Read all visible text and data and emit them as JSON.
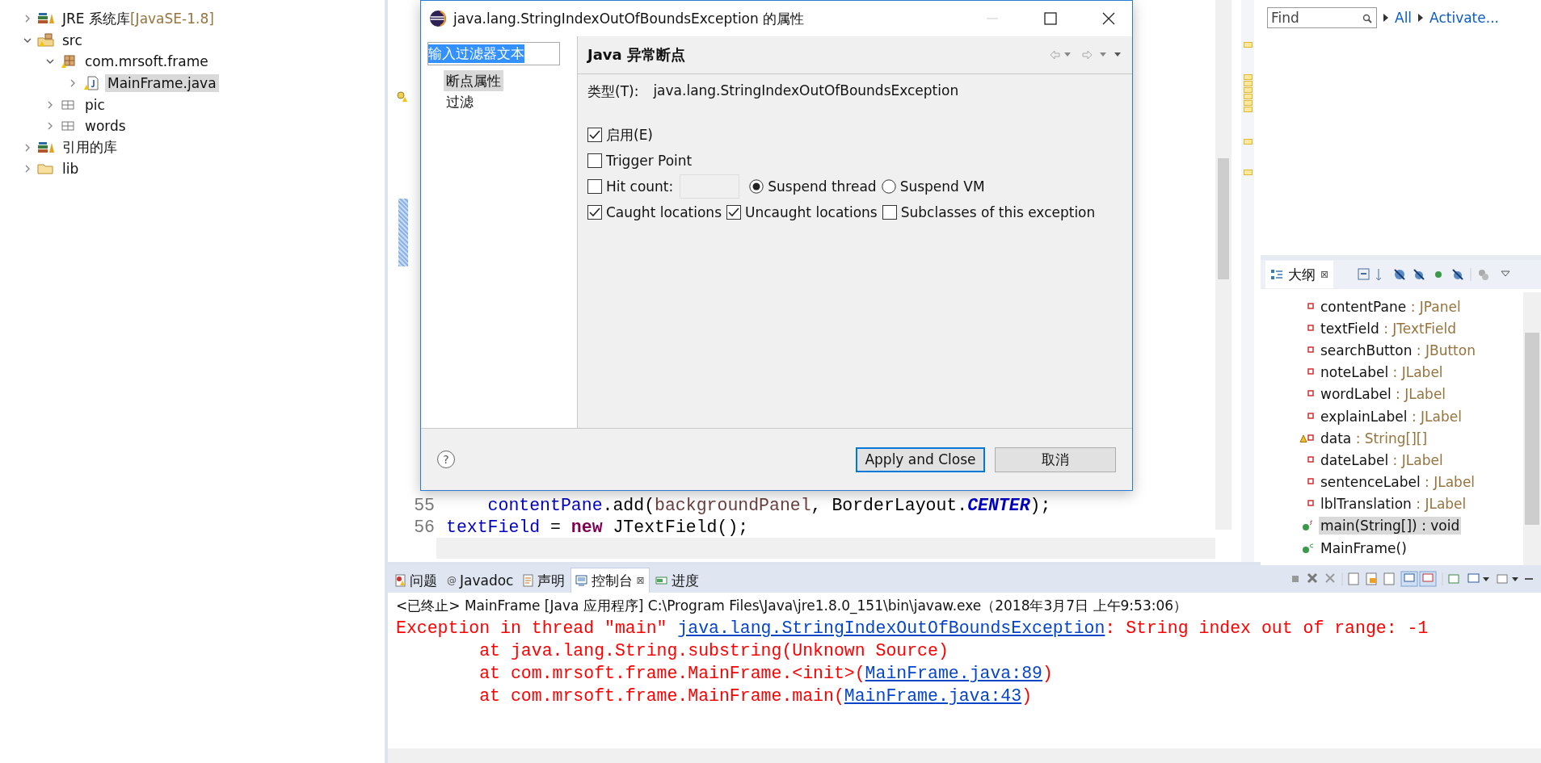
{
  "explorer": {
    "items": [
      {
        "kind": "library",
        "label": "JRE 系统库",
        "suffix": "[JavaSE-1.8]",
        "expanded": false,
        "selected": false
      },
      {
        "kind": "source",
        "label": "src",
        "expanded": true,
        "selected": false,
        "children": [
          {
            "kind": "package",
            "label": "com.mrsoft.frame",
            "expanded": true,
            "selected": false,
            "children": [
              {
                "kind": "java",
                "label": "MainFrame.java",
                "expanded": false,
                "selected": true
              }
            ]
          },
          {
            "kind": "plainpackage",
            "label": "pic",
            "expanded": false,
            "selected": false
          },
          {
            "kind": "plainpackage",
            "label": "words",
            "expanded": false,
            "selected": false
          }
        ]
      },
      {
        "kind": "library",
        "label": "引用的库",
        "expanded": false,
        "selected": false
      },
      {
        "kind": "folder",
        "label": "lib",
        "expanded": false,
        "selected": false
      }
    ]
  },
  "editor": {
    "lines": [
      {
        "number": "55",
        "tokens": [
          {
            "kind": "field",
            "text": "    contentPane"
          },
          {
            "kind": "plain",
            "text": ".add("
          },
          {
            "kind": "local",
            "text": "backgroundPanel"
          },
          {
            "kind": "plain",
            "text": ", BorderLayout."
          },
          {
            "kind": "constant",
            "text": "CENTER"
          },
          {
            "kind": "plain",
            "text": ");"
          }
        ]
      },
      {
        "number": "56",
        "tokens": [
          {
            "kind": "field",
            "text": "textField"
          },
          {
            "kind": "plain",
            "text": " = "
          },
          {
            "kind": "keyword",
            "text": "new"
          },
          {
            "kind": "plain",
            "text": " JTextField();"
          }
        ]
      }
    ]
  },
  "dialog": {
    "title": "java.lang.StringIndexOutOfBoundsException 的属性",
    "filter": {
      "value": "输入过滤器文本"
    },
    "pages": [
      {
        "label": "断点属性",
        "selected": true
      },
      {
        "label": "过滤",
        "selected": false
      }
    ],
    "page_title": "Java 异常断点",
    "type_label": "类型(T):",
    "type_value": "java.lang.StringIndexOutOfBoundsException",
    "rows": [
      {
        "controls": [
          {
            "kind": "checkbox",
            "label": "启用(E)",
            "checked": true
          }
        ]
      },
      {
        "controls": [
          {
            "kind": "checkbox",
            "label": "Trigger Point",
            "checked": false
          }
        ]
      },
      {
        "controls": [
          {
            "kind": "checkbox",
            "label": "Hit count:",
            "checked": false
          },
          {
            "kind": "field",
            "disabled": true
          },
          {
            "kind": "radio",
            "label": "Suspend thread",
            "selected": true
          },
          {
            "kind": "radio",
            "label": "Suspend VM",
            "selected": false
          }
        ]
      },
      {
        "controls": [
          {
            "kind": "checkbox",
            "label": "Caught locations",
            "checked": true
          },
          {
            "kind": "checkbox",
            "label": "Uncaught locations",
            "checked": true
          },
          {
            "kind": "checkbox",
            "label": "Subclasses of this exception",
            "checked": false
          }
        ]
      }
    ],
    "help": "?",
    "buttons": [
      {
        "label": "Apply and Close",
        "default": true
      },
      {
        "label": "取消",
        "default": false
      }
    ]
  },
  "tasks": {
    "find": {
      "placeholder": "Find"
    },
    "links": [
      "All",
      "Activate..."
    ]
  },
  "outline": {
    "title": "大纲",
    "close": "⊠",
    "items": [
      {
        "kind": "field",
        "name": "contentPane",
        "type": " : JPanel",
        "warning": false,
        "selected": false
      },
      {
        "kind": "field",
        "name": "textField",
        "type": " : JTextField",
        "warning": false,
        "selected": false
      },
      {
        "kind": "field",
        "name": "searchButton",
        "type": " : JButton",
        "warning": false,
        "selected": false
      },
      {
        "kind": "field",
        "name": "noteLabel",
        "type": " : JLabel",
        "warning": false,
        "selected": false
      },
      {
        "kind": "field",
        "name": "wordLabel",
        "type": " : JLabel",
        "warning": false,
        "selected": false
      },
      {
        "kind": "field",
        "name": "explainLabel",
        "type": " : JLabel",
        "warning": false,
        "selected": false
      },
      {
        "kind": "field",
        "name": "data",
        "type": " : String[][]",
        "warning": true,
        "selected": false
      },
      {
        "kind": "field",
        "name": "dateLabel",
        "type": " : JLabel",
        "warning": false,
        "selected": false
      },
      {
        "kind": "field",
        "name": "sentenceLabel",
        "type": " : JLabel",
        "warning": false,
        "selected": false
      },
      {
        "kind": "field",
        "name": "lblTranslation",
        "type": " : JLabel",
        "warning": false,
        "selected": false
      },
      {
        "kind": "method",
        "name": "main(String[]) : void",
        "selected": true
      },
      {
        "kind": "constructor",
        "name": "MainFrame()",
        "selected": false
      }
    ]
  },
  "console": {
    "tabs": [
      {
        "kind": "problems",
        "label": "问题",
        "selected": false
      },
      {
        "kind": "javadoc",
        "glyph": "@",
        "label": "Javadoc",
        "selected": false
      },
      {
        "kind": "declaration",
        "label": "声明",
        "selected": false
      },
      {
        "kind": "console",
        "label": "控制台",
        "close": "⊠",
        "selected": true
      },
      {
        "kind": "progress",
        "label": "进度",
        "selected": false
      }
    ],
    "header": "<已终止> MainFrame [Java 应用程序] C:\\Program Files\\Java\\jre1.8.0_151\\bin\\javaw.exe（2018年3月7日 上午9:53:06）",
    "lines": [
      [
        {
          "text": "Exception in thread \"main\" ",
          "link": false
        },
        {
          "text": "java.lang.StringIndexOutOfBoundsException",
          "link": true
        },
        {
          "text": ": String index out of range: -1",
          "link": false
        }
      ],
      [
        {
          "text": "\tat java.lang.String.substring(Unknown Source)",
          "link": false
        }
      ],
      [
        {
          "text": "\tat com.mrsoft.frame.MainFrame.<init>(",
          "link": false
        },
        {
          "text": "MainFrame.java:89",
          "link": true
        },
        {
          "text": ")",
          "link": false
        }
      ],
      [
        {
          "text": "\tat com.mrsoft.frame.MainFrame.main(",
          "link": false
        },
        {
          "text": "MainFrame.java:43",
          "link": true
        },
        {
          "text": ")",
          "link": false
        }
      ]
    ]
  }
}
